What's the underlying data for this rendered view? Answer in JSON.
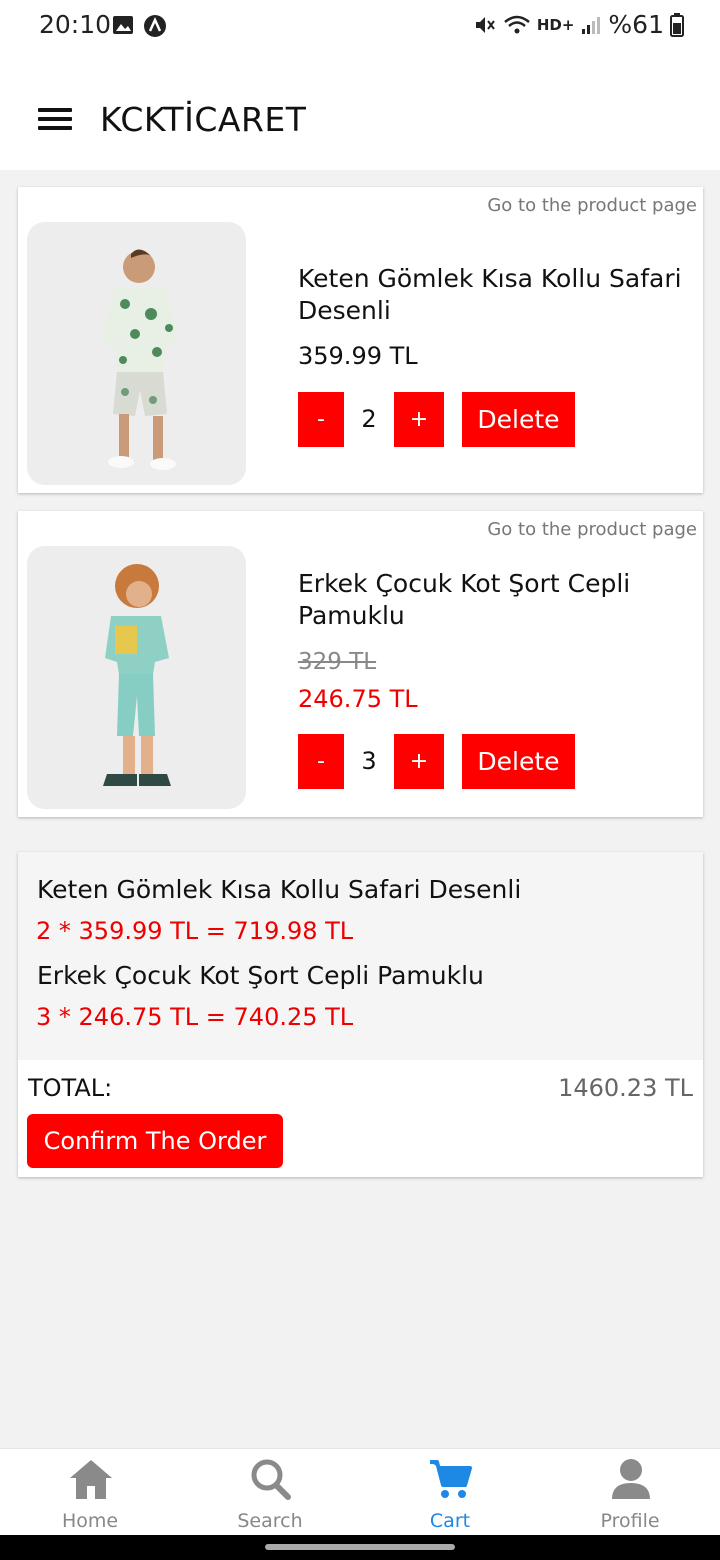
{
  "status_bar": {
    "time": "20:10",
    "network": "HD+",
    "battery": "%61"
  },
  "app_bar": {
    "title": "KCKTİCARET"
  },
  "cart": {
    "items": [
      {
        "goto_label": "Go to the product page",
        "name": "Keten Gömlek Kısa Kollu Safari Desenli",
        "price": "359.99 TL",
        "quantity": "2",
        "minus": "-",
        "plus": "+",
        "delete_label": "Delete"
      },
      {
        "goto_label": "Go to the product page",
        "name": "Erkek Çocuk Kot Şort Cepli Pamuklu",
        "old_price": "329 TL",
        "price": "246.75 TL",
        "quantity": "3",
        "minus": "-",
        "plus": "+",
        "delete_label": "Delete"
      }
    ]
  },
  "summary": {
    "lines": [
      {
        "name": "Keten Gömlek Kısa Kollu Safari Desenli",
        "calc": "2 *  359.99 TL =  719.98 TL"
      },
      {
        "name": "Erkek Çocuk Kot Şort Cepli Pamuklu",
        "calc": "3 *  246.75 TL =  740.25 TL"
      }
    ],
    "total_label": "TOTAL:",
    "total_value": "1460.23 TL",
    "confirm_label": "Confirm The Order"
  },
  "bottom_nav": [
    {
      "label": "Home",
      "icon": "home-icon",
      "active": false
    },
    {
      "label": "Search",
      "icon": "search-icon",
      "active": false
    },
    {
      "label": "Cart",
      "icon": "cart-icon",
      "active": true
    },
    {
      "label": "Profile",
      "icon": "person-icon",
      "active": false
    }
  ],
  "colors": {
    "accent": "#ff0000",
    "price_red": "#e00000",
    "nav_active": "#1e88e5"
  }
}
